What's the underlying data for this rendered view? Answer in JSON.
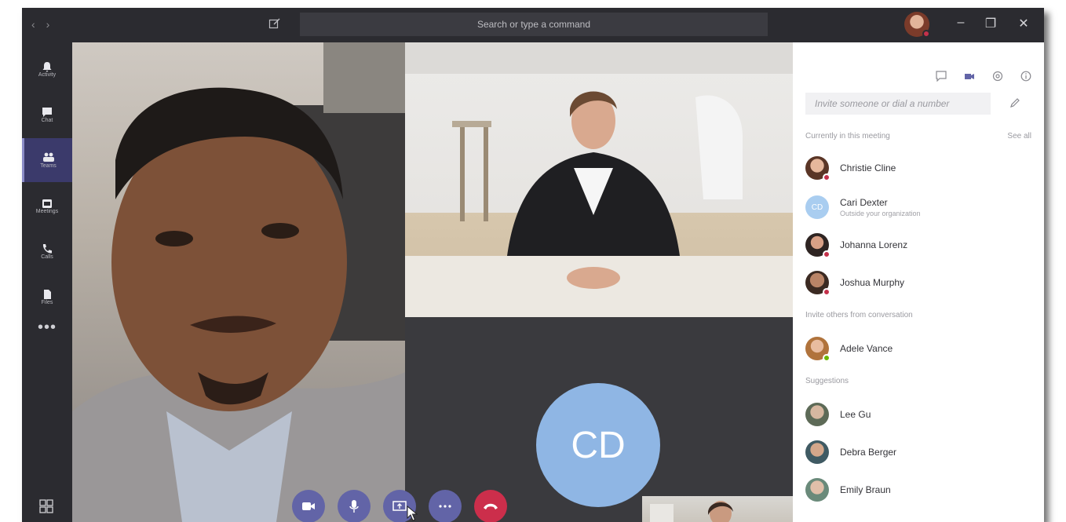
{
  "titlebar": {
    "back_icon": "chevron-left-icon",
    "forward_icon": "chevron-right-icon",
    "compose_icon": "compose-icon",
    "search_placeholder": "Search or type a command",
    "minimize": "–",
    "maximize": "❐",
    "close": "✕"
  },
  "rail": {
    "items": [
      {
        "label": "Activity",
        "icon": "bell-icon"
      },
      {
        "label": "Chat",
        "icon": "chat-icon"
      },
      {
        "label": "Teams",
        "icon": "teams-icon",
        "active": true
      },
      {
        "label": "Meetings",
        "icon": "calendar-icon"
      },
      {
        "label": "Calls",
        "icon": "phone-icon"
      },
      {
        "label": "Files",
        "icon": "file-icon"
      }
    ],
    "more": "•••",
    "apps_icon": "apps-icon"
  },
  "stage": {
    "avatar_initials": "CD"
  },
  "controls": {
    "buttons": [
      "video-icon",
      "mic-icon",
      "share-screen-icon",
      "more-icon",
      "hang-up-icon"
    ]
  },
  "panel": {
    "header_icons": [
      "chat-icon",
      "video-call-icon",
      "gear-icon",
      "info-icon"
    ],
    "invite_placeholder": "Invite someone or dial a number",
    "sections": {
      "current": "Currently in this meeting",
      "see_all": "See all",
      "invite_others": "Invite others from conversation",
      "suggestions": "Suggestions"
    },
    "current": [
      {
        "name": "Christie Cline",
        "status": "busy"
      },
      {
        "name": "Cari Dexter",
        "sub": "Outside your organization",
        "initials": "CD"
      },
      {
        "name": "Johanna Lorenz",
        "status": "busy"
      },
      {
        "name": "Joshua Murphy",
        "status": "busy"
      }
    ],
    "invite_others": [
      {
        "name": "Adele Vance",
        "status": "available"
      }
    ],
    "suggestions": [
      {
        "name": "Lee Gu"
      },
      {
        "name": "Debra Berger"
      },
      {
        "name": "Emily Braun"
      }
    ],
    "colors": {
      "busy": "#c4314b",
      "available": "#6bb700",
      "accent": "#6264a7"
    }
  }
}
